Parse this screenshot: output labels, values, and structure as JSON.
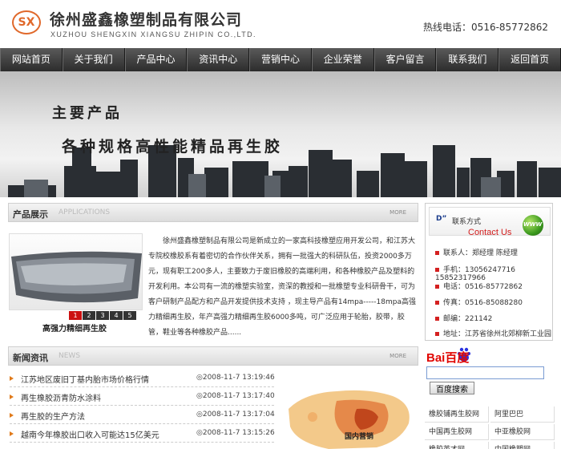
{
  "header": {
    "logo_text": "SX",
    "company_name": "徐州盛鑫橡塑制品有限公司",
    "company_en": "XUZHOU SHENGXIN XIANGSU ZHIPIN CO.,LTD.",
    "hotline": "热线电话：0516-85772862"
  },
  "nav": [
    "网站首页",
    "关于我们",
    "产品中心",
    "资讯中心",
    "营销中心",
    "企业荣誉",
    "客户留言",
    "联系我们",
    "返回首页"
  ],
  "banner": {
    "title": "主要产品",
    "slogan": "各种规格高性能精品再生胶"
  },
  "products": {
    "title": "产品展示",
    "subtitle": "APPLICATIONS",
    "more": "MORE",
    "caption": "高强力精细再生胶",
    "pager": [
      "1",
      "2",
      "3",
      "4",
      "5"
    ],
    "intro": "徐州盛鑫橡塑制品有限公司是新成立的一家高科技橡塑应用开发公司，和江苏大专院校橡胶系有着密切的合作伙伴关系，拥有一批强大的科研队伍，投资2000多万元，现有职工200多人，主要致力于废旧橡胶的高端利用，和各种橡胶产品及塑料的开发利用。本公司有一流的橡塑实验室，资深的教授和一批橡塑专业科研骨干，可为客户研制产品配方和产品开发提供技术支持 ，现主导产品有14mpa-----18mpa高强力精细再生胶，年产高强力精细再生胶6000多吨，可广泛应用于轮胎，胶带，胶管，鞋业等各种橡胶产品......"
  },
  "news": {
    "title": "新闻资讯",
    "subtitle": "NEWS",
    "more": "MORE",
    "items": [
      {
        "title": "江苏地区废旧丁基内胎市场价格行情",
        "date": "◎2008-11-7 13:19:46"
      },
      {
        "title": "再生橡胶沥青防水涂料",
        "date": "◎2008-11-7 13:17:40"
      },
      {
        "title": "再生胶的生产方法",
        "date": "◎2008-11-7 13:17:04"
      },
      {
        "title": "越南今年橡胶出口收入可能达15亿美元",
        "date": "◎2008-11-7 13:15:26"
      }
    ],
    "map_label": "国内营销"
  },
  "contact": {
    "d_mark": "D”",
    "label": "联系方式",
    "contact_us": "Contact Us",
    "www": "WWW",
    "rows": [
      "联系人：郑经理   陈经理",
      "手机：13056247716 15852317966",
      "电话：0516-85772862",
      "传真：0516-85088280",
      "邮编：221142",
      "地址：江苏省徐州北郊柳新工业园"
    ]
  },
  "search": {
    "logo": "Bai百度",
    "button": "百度搜索",
    "value": ""
  },
  "links": [
    "橡胶铺再生胶网",
    "阿里巴巴",
    "中国再生胶网",
    "中亚橡胶网",
    "橡胶英才网",
    "中国橡塑网"
  ],
  "colors": {
    "nav_bg": "#3a3a3a",
    "accent_orange": "#e07a1a",
    "pager_active": "#cc1111",
    "contact_red": "#d42020"
  }
}
